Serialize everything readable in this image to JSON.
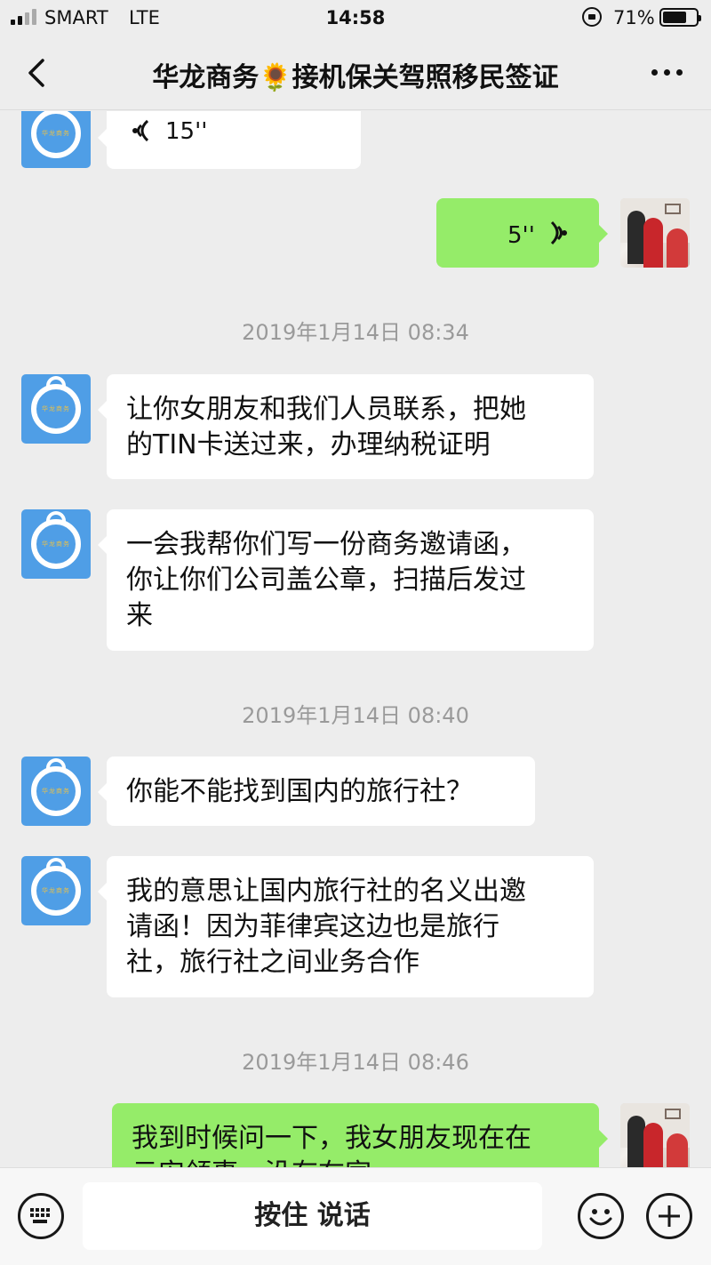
{
  "status_bar": {
    "carrier": "SMART",
    "network": "LTE",
    "time": "14:58",
    "battery_percent": "71%",
    "battery_level": 0.71
  },
  "nav": {
    "title": "华龙商务🌻接机保关驾照移民签证"
  },
  "messages": [
    {
      "type": "voice",
      "direction": "in",
      "duration": "15''"
    },
    {
      "type": "voice",
      "direction": "out",
      "duration": "5''"
    },
    {
      "type": "timestamp",
      "text": "2019年1月14日 08:34"
    },
    {
      "type": "text",
      "direction": "in",
      "lines": [
        "让你女朋友和我们人员联系，把她",
        "的TIN卡送过来，办理纳税证明"
      ]
    },
    {
      "type": "text",
      "direction": "in",
      "lines": [
        "一会我帮你们写一份商务邀请函，",
        "你让你们公司盖公章，扫描后发过",
        "来"
      ]
    },
    {
      "type": "timestamp",
      "text": "2019年1月14日 08:40"
    },
    {
      "type": "text",
      "direction": "in",
      "lines": [
        "你能不能找到国内的旅行社？"
      ]
    },
    {
      "type": "text",
      "direction": "in",
      "lines": [
        "我的意思让国内旅行社的名义出邀",
        "请函！因为菲律宾这边也是旅行",
        "社，旅行社之间业务合作"
      ]
    },
    {
      "type": "timestamp",
      "text": "2019年1月14日 08:46"
    },
    {
      "type": "text",
      "direction": "out",
      "lines": [
        "我到时候问一下，我女朋友现在在",
        "云安领事，没有在家"
      ]
    }
  ],
  "input_bar": {
    "talk_label": "按住 说话"
  },
  "icons": {
    "back": "chevron-left-icon",
    "more": "more-dots-icon",
    "keyboard": "keyboard-icon",
    "emoji": "emoji-icon",
    "plus": "plus-icon",
    "voice_in": "voice-wave-icon",
    "voice_out": "voice-wave-icon"
  },
  "colors": {
    "background": "#ededed",
    "incoming_bubble": "#ffffff",
    "outgoing_bubble": "#95ec69",
    "avatar_blue": "#4f9ee6",
    "timestamp_text": "#9a9a9a"
  }
}
